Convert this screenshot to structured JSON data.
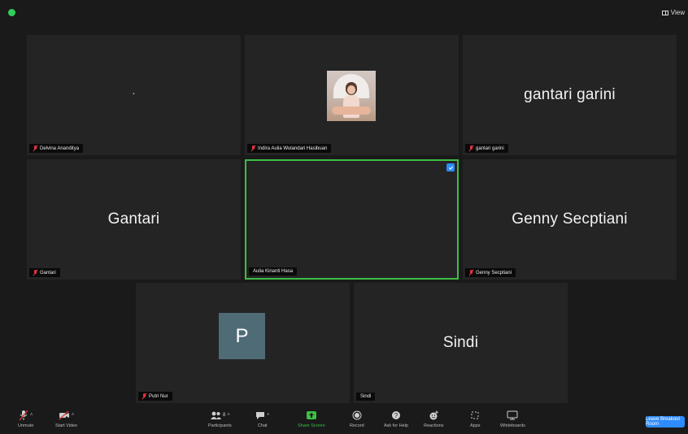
{
  "window": {
    "view_label": "View",
    "colors": {
      "background": "#1a1a1a",
      "tile": "#242424",
      "active_border": "#3fbd44",
      "muted_red": "#e5343b",
      "accent_blue": "#2d8cff"
    }
  },
  "participants": [
    {
      "display": "·",
      "label": "Delvina Ananditya",
      "muted": true
    },
    {
      "display": "",
      "label": "Indira Aulia Wulandari Hasibuan",
      "muted": true
    },
    {
      "display": "gantari garini",
      "label": "gantari garini",
      "muted": true
    },
    {
      "display": "Gantari",
      "label": "Gantari",
      "muted": true
    },
    {
      "display": "",
      "label": "Aulia Kinanti Hasa",
      "muted": false,
      "active_speaker": true
    },
    {
      "display": "Genny Secptiani",
      "label": "Genny Secptiani",
      "muted": true
    },
    {
      "display": "P",
      "label": "Putri Nur",
      "muted": true
    },
    {
      "display": "Sindi",
      "label": "Sindi",
      "muted": false
    }
  ],
  "toolbar": {
    "unmute": "Unmute",
    "start_video": "Start Video",
    "participants": "Participants",
    "participants_count": "8",
    "chat": "Chat",
    "share_screen": "Share Screen",
    "record": "Record",
    "ask_for_help": "Ask for Help",
    "reactions": "Reactions",
    "apps": "Apps",
    "whiteboards": "Whiteboards",
    "leave": "Leave Breakout Room"
  },
  "icons": [
    "security-shield-icon",
    "view-icon",
    "mute-mic-icon",
    "pin-icon",
    "microphone-icon",
    "video-camera-icon",
    "participants-icon",
    "chat-icon",
    "share-screen-icon",
    "record-icon",
    "help-icon",
    "reactions-icon",
    "apps-icon",
    "whiteboard-icon"
  ]
}
